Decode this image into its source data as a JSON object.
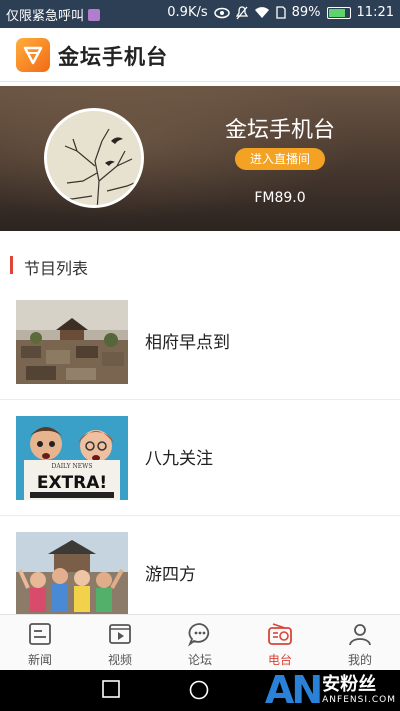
{
  "status_bar": {
    "carrier": "仅限紧急呼叫",
    "speed": "0.9K/s",
    "battery": "89%",
    "battery_level": 0.89,
    "time": "11:21"
  },
  "header": {
    "title": "金坛手机台"
  },
  "hero": {
    "title": "金坛手机台",
    "live_button": "进入直播间",
    "frequency": "FM89.0"
  },
  "section": {
    "title": "节目列表"
  },
  "programs": [
    {
      "title": "相府早点到"
    },
    {
      "title": "八九关注"
    },
    {
      "title": "游四方"
    }
  ],
  "bottom_nav": [
    {
      "label": "新闻",
      "icon": "news-icon"
    },
    {
      "label": "视频",
      "icon": "video-icon"
    },
    {
      "label": "论坛",
      "icon": "forum-icon"
    },
    {
      "label": "电台",
      "icon": "radio-icon"
    },
    {
      "label": "我的",
      "icon": "profile-icon"
    }
  ],
  "active_nav": "电台",
  "watermark": {
    "logo": "AN",
    "cn": "安粉丝",
    "en": "ANFENSI.COM"
  },
  "colors": {
    "accent": "#d9453a",
    "live_button": "#f4a224",
    "status_bar": "#2d3f54"
  }
}
